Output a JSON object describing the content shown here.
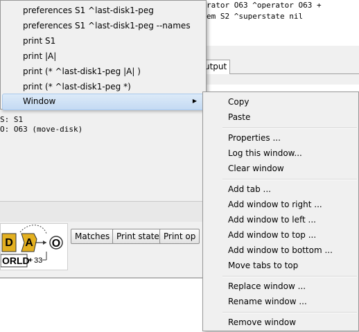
{
  "background": {
    "console_lines": [
      "rator O63 ^operator O63 +",
      "em S2 ^superstate nil"
    ],
    "tab_output_label": "utput",
    "panel_lines": [
      "S: S1",
      "O: O63 (move-disk)"
    ],
    "toolbar_buttons": [
      "Matches",
      "Print state",
      "Print op"
    ],
    "logo": {
      "letters": [
        "D",
        "A",
        "O"
      ],
      "word": "ORLD",
      "number": "33"
    }
  },
  "context_menu": {
    "items": [
      "preferences S1 ^last-disk1-peg",
      "preferences S1 ^last-disk1-peg --names",
      "print S1",
      "print |A|",
      "print (* ^last-disk1-peg |A| )",
      "print (* ^last-disk1-peg *)",
      "Window"
    ],
    "submenu_arrow": "▶"
  },
  "window_submenu": {
    "items": [
      "Copy",
      "Paste",
      "Properties ...",
      "Log this window...",
      "Clear window",
      "Add tab ...",
      "Add window to right ...",
      "Add window to left ...",
      "Add window to top ...",
      "Add window to bottom ...",
      "Move tabs to top",
      "Replace window ...",
      "Rename window ...",
      "Remove window"
    ]
  }
}
